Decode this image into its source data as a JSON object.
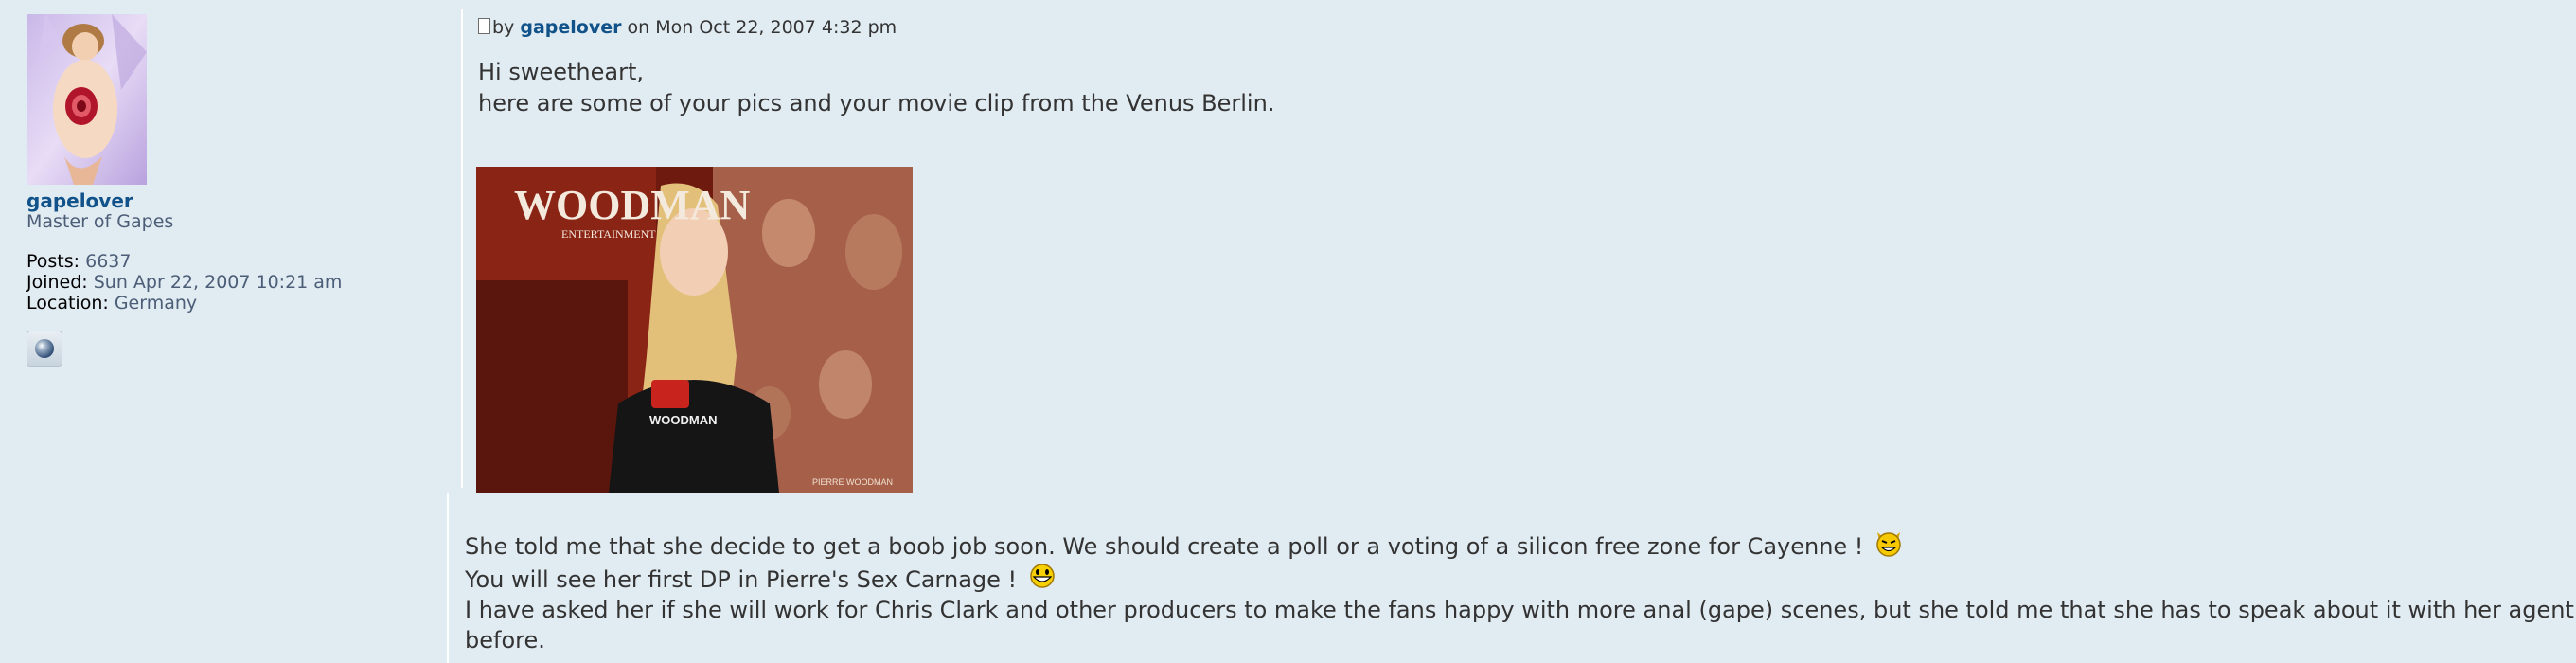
{
  "profile": {
    "username": "gapelover",
    "rank": "Master of Gapes",
    "posts_label": "Posts:",
    "posts_value": "6637",
    "joined_label": "Joined:",
    "joined_value": "Sun Apr 22, 2007 10:21 am",
    "location_label": "Location:",
    "location_value": "Germany",
    "contact_icon": "website-globe-icon"
  },
  "post": {
    "author_prefix": "by",
    "author": "gapelover",
    "date_prefix": "on",
    "date": "Mon Oct 22, 2007 4:32 pm",
    "greeting": "Hi sweetheart,",
    "intro": "here are some of your pics and your movie clip from the Venus Berlin.",
    "image_text": {
      "banner": "WOODMAN",
      "banner_sub": "ENTERTAINMENT",
      "shirt": "WOODMAN",
      "poster_credit": "PIERRE WOODMAN"
    },
    "paragraph_1": "She told me that she decide to get a boob job soon. We should create a poll or a voting of a silicon free zone for Cayenne !",
    "paragraph_2": "You will see her first DP in Pierre's Sex Carnage !",
    "paragraph_3a": "I have asked her if she will work for Chris Clark and other producers to make the fans happy with more anal (gape) scenes, but she told me that she has to speak about it with her agent Ricardo",
    "paragraph_3b": "before.",
    "smilies": [
      "evil-smiley-icon",
      "grin-smiley-icon"
    ]
  },
  "colors": {
    "background": "#e1ebf2",
    "link": "#105289",
    "text": "#333333",
    "muted": "#4c5d77"
  }
}
